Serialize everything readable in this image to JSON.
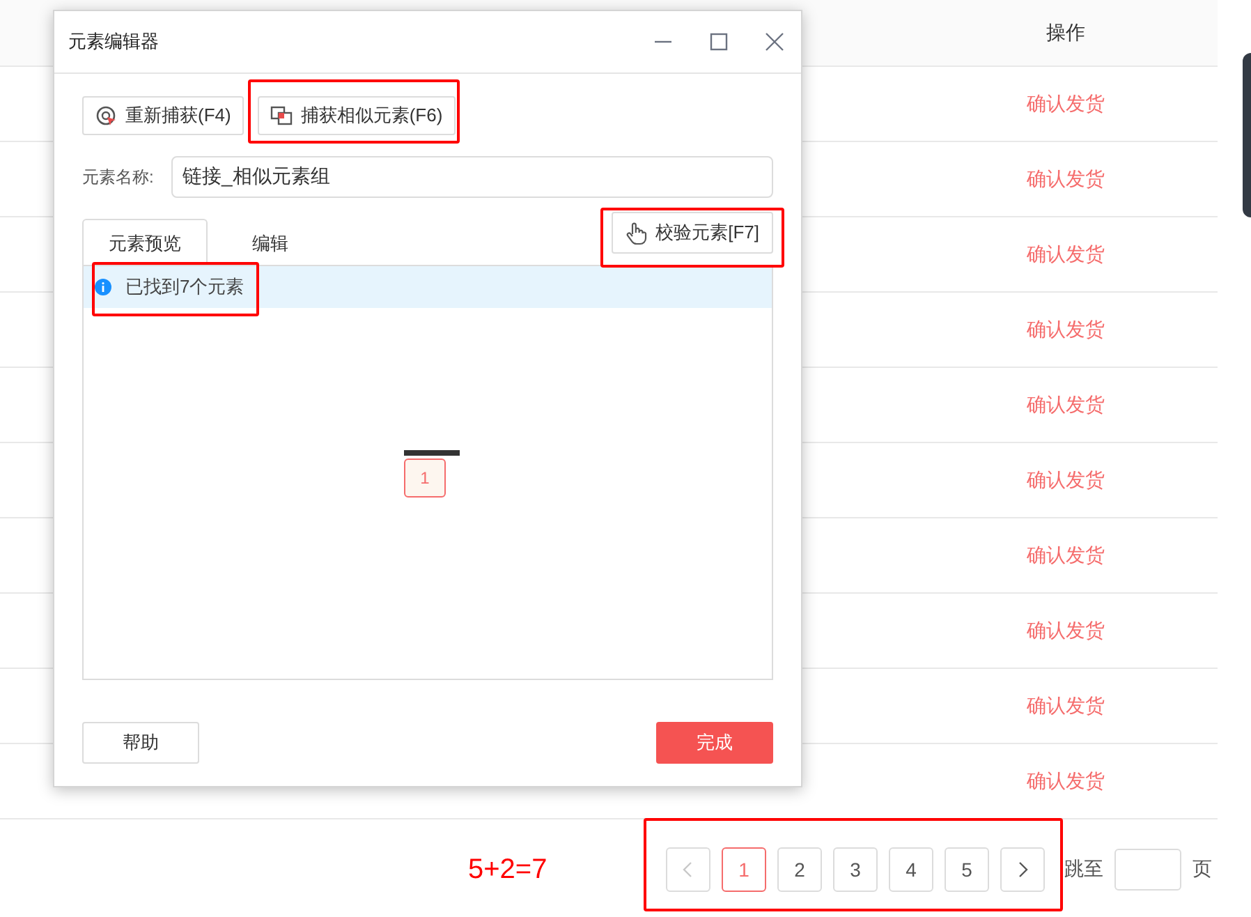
{
  "window": {
    "title": "元素编辑器"
  },
  "toolbar": [
    {
      "label": "重新捕获(F4)",
      "kind": "recapture"
    },
    {
      "label": "捕获相似元素(F6)",
      "kind": "similar"
    }
  ],
  "name_field": {
    "label": "元素名称:",
    "value": "链接_相似元素组"
  },
  "tabs": [
    {
      "label": "元素预览",
      "selected": true
    },
    {
      "label": "编辑",
      "selected": false
    }
  ],
  "verify_button": "校验元素[F7]",
  "info": "已找到7个元素",
  "preview": {
    "badge": "1"
  },
  "footer": {
    "help": "帮助",
    "done": "完成"
  },
  "background_table": {
    "columns": [
      "操作"
    ],
    "rows": [
      {
        "action": "确认发货"
      },
      {
        "action": "确认发货"
      },
      {
        "action": "确认发货"
      },
      {
        "action": "确认发货"
      },
      {
        "action": "确认发货"
      },
      {
        "action": "确认发货"
      },
      {
        "action": "确认发货"
      },
      {
        "action": "确认发货"
      },
      {
        "action": "确认发货"
      },
      {
        "action": "确认发货"
      }
    ]
  },
  "pagination": {
    "prev": {
      "disabled": true
    },
    "next": {
      "disabled": false
    },
    "pages": [
      {
        "label": "1",
        "selected": true
      },
      {
        "label": "2",
        "selected": false
      },
      {
        "label": "3",
        "selected": false
      },
      {
        "label": "4",
        "selected": false
      },
      {
        "label": "5",
        "selected": false
      }
    ],
    "jump_label": "跳至",
    "page_suffix": "页"
  },
  "annotation": "5+2=7"
}
